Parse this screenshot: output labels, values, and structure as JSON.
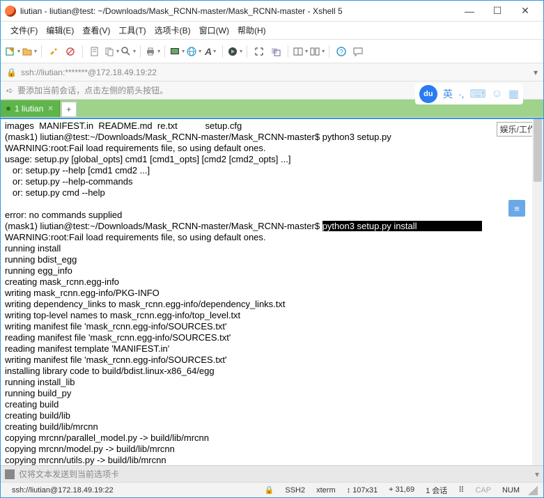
{
  "window": {
    "title": "liutian - liutian@test: ~/Downloads/Mask_RCNN-master/Mask_RCNN-master - Xshell 5"
  },
  "menu": {
    "file": "文件(F)",
    "edit": "编辑(E)",
    "view": "查看(V)",
    "tools": "工具(T)",
    "tabs": "选项卡(B)",
    "window": "窗口(W)",
    "help": "帮助(H)"
  },
  "address": {
    "url": "ssh://liutian:*******@172.18.49.19:22"
  },
  "tip": {
    "text": "要添加当前会话，点击左侧的箭头按钮。"
  },
  "ime": {
    "baidu": "du",
    "lang": "英",
    "punct": "·,"
  },
  "tabs": {
    "active": "1 liutian",
    "add": "+"
  },
  "terminal": {
    "sidebutton": "娱乐/工作",
    "line01": "images  MANIFEST.in  README.md  re.txt           setup.cfg",
    "line02": "(mask1) liutian@test:~/Downloads/Mask_RCNN-master/Mask_RCNN-master$ python3 setup.py",
    "line03": "WARNING:root:Fail load requirements file, so using default ones.",
    "line04": "usage: setup.py [global_opts] cmd1 [cmd1_opts] [cmd2 [cmd2_opts] ...]",
    "line05": "   or: setup.py --help [cmd1 cmd2 ...]",
    "line06": "   or: setup.py --help-commands",
    "line07": "   or: setup.py cmd --help",
    "line08": "",
    "line09": "error: no commands supplied",
    "line10_prompt": "(mask1) liutian@test:~/Downloads/Mask_RCNN-master/Mask_RCNN-master$ ",
    "line10_hl": "python3 setup.py install",
    "line11": "WARNING:root:Fail load requirements file, so using default ones.",
    "line12": "running install",
    "line13": "running bdist_egg",
    "line14": "running egg_info",
    "line15": "creating mask_rcnn.egg-info",
    "line16": "writing mask_rcnn.egg-info/PKG-INFO",
    "line17": "writing dependency_links to mask_rcnn.egg-info/dependency_links.txt",
    "line18": "writing top-level names to mask_rcnn.egg-info/top_level.txt",
    "line19": "writing manifest file 'mask_rcnn.egg-info/SOURCES.txt'",
    "line20": "reading manifest file 'mask_rcnn.egg-info/SOURCES.txt'",
    "line21": "reading manifest template 'MANIFEST.in'",
    "line22": "writing manifest file 'mask_rcnn.egg-info/SOURCES.txt'",
    "line23": "installing library code to build/bdist.linux-x86_64/egg",
    "line24": "running install_lib",
    "line25": "running build_py",
    "line26": "creating build",
    "line27": "creating build/lib",
    "line28": "creating build/lib/mrcnn",
    "line29": "copying mrcnn/parallel_model.py -> build/lib/mrcnn",
    "line30": "copying mrcnn/model.py -> build/lib/mrcnn",
    "line31": "copying mrcnn/utils.py -> build/lib/mrcnn"
  },
  "sendbar": {
    "text": "仅将文本发送到当前选项卡"
  },
  "status": {
    "conn": "ssh://liutian@172.18.49.19:22",
    "proto": "SSH2",
    "term": "xterm",
    "size": "107x31",
    "cursor": "31,69",
    "sessions": "1 会话",
    "cap": "CAP",
    "num": "NUM"
  }
}
